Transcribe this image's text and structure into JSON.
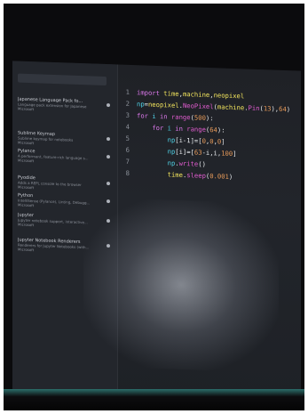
{
  "sidebar": {
    "items": [
      {
        "name": "Japanese Language Pack fo...",
        "desc": "Language pack extension for Japanese"
      },
      {
        "name": "Sublime Keymap",
        "desc": "Sublime keymap for notebooks"
      },
      {
        "name": "Pylance",
        "desc": "A performant, feature-rich language s..."
      },
      {
        "name": "Pyodide",
        "desc": "Adds a REPL console to the browser"
      },
      {
        "name": "Python",
        "desc": "IntelliSense (Pylance), Linting, Debugg..."
      },
      {
        "name": "Jupyter",
        "desc": "Jupyter notebook support, interactive..."
      },
      {
        "name": "Jupyter Notebook Renderers",
        "desc": "Renderers for Jupyter Notebooks (with..."
      }
    ],
    "publisher": "Microsoft"
  },
  "editor": {
    "lines": [
      {
        "num": "1",
        "tokens": [
          [
            "kw",
            "import "
          ],
          [
            "mod",
            "time"
          ],
          [
            "plain",
            ","
          ],
          [
            "mod",
            "machine"
          ],
          [
            "plain",
            ","
          ],
          [
            "mod",
            "neopixel"
          ]
        ]
      },
      {
        "num": "2",
        "tokens": [
          [
            "var",
            "np"
          ],
          [
            "plain",
            "="
          ],
          [
            "mod",
            "neopixel"
          ],
          [
            "plain",
            "."
          ],
          [
            "fn",
            "NeoPixel"
          ],
          [
            "plain",
            "("
          ],
          [
            "mod",
            "machine"
          ],
          [
            "plain",
            "."
          ],
          [
            "fn",
            "Pin"
          ],
          [
            "plain",
            "("
          ],
          [
            "num",
            "13"
          ],
          [
            "plain",
            "),"
          ],
          [
            "num",
            "64"
          ],
          [
            "plain",
            ")"
          ]
        ]
      },
      {
        "num": "3",
        "tokens": [
          [
            "kw",
            "for "
          ],
          [
            "var",
            "i "
          ],
          [
            "kw",
            "in "
          ],
          [
            "fn",
            "range"
          ],
          [
            "plain",
            "("
          ],
          [
            "num",
            "500"
          ],
          [
            "plain",
            "):"
          ]
        ]
      },
      {
        "num": "4",
        "tokens": [
          [
            "plain",
            "    "
          ],
          [
            "kw",
            "for "
          ],
          [
            "var",
            "i "
          ],
          [
            "kw",
            "in "
          ],
          [
            "fn",
            "range"
          ],
          [
            "plain",
            "("
          ],
          [
            "num",
            "64"
          ],
          [
            "plain",
            "):"
          ]
        ]
      },
      {
        "num": "5",
        "tokens": [
          [
            "plain",
            "        "
          ],
          [
            "var",
            "np"
          ],
          [
            "plain",
            "[i-1]=["
          ],
          [
            "num",
            "0"
          ],
          [
            "plain",
            ","
          ],
          [
            "num",
            "0"
          ],
          [
            "plain",
            ","
          ],
          [
            "num",
            "0"
          ],
          [
            "plain",
            "]"
          ]
        ]
      },
      {
        "num": "6",
        "tokens": [
          [
            "plain",
            "        "
          ],
          [
            "var",
            "np"
          ],
          [
            "plain",
            "[i]=["
          ],
          [
            "num",
            "63"
          ],
          [
            "plain",
            "-i,i,"
          ],
          [
            "num",
            "100"
          ],
          [
            "plain",
            "]"
          ]
        ]
      },
      {
        "num": "7",
        "tokens": [
          [
            "plain",
            "        "
          ],
          [
            "var",
            "np"
          ],
          [
            "plain",
            "."
          ],
          [
            "fn",
            "write"
          ],
          [
            "plain",
            "()"
          ]
        ]
      },
      {
        "num": "8",
        "tokens": [
          [
            "plain",
            "        "
          ],
          [
            "mod",
            "time"
          ],
          [
            "plain",
            "."
          ],
          [
            "fn",
            "sleep"
          ],
          [
            "plain",
            "("
          ],
          [
            "num",
            "0.001"
          ],
          [
            "plain",
            ")"
          ]
        ]
      }
    ]
  }
}
